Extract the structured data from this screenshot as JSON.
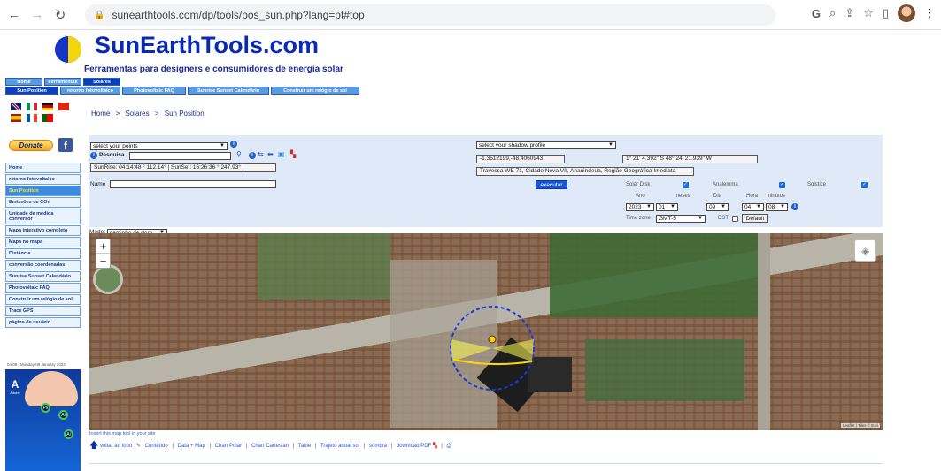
{
  "browser": {
    "url": "sunearthtools.com/dp/tools/pos_sun.php?lang=pt#top"
  },
  "site": {
    "title": "SunEarthTools.com",
    "subtitle": "Ferramentas para designers e consumidores de energia solar"
  },
  "tabs_top": [
    "Home",
    "Ferramentas",
    "Solares"
  ],
  "tabs_sub": [
    "Sun Position",
    "retorno fotovoltaico",
    "Photovoltaic FAQ",
    "Sunrise Sunset Calendário",
    "Construir um relógio de sol"
  ],
  "breadcrumb": {
    "home": "Home",
    "sep": ">",
    "section": "Solares",
    "page": "Sun Position"
  },
  "donate_label": "Donate",
  "fb_label": "f",
  "sidebar": {
    "items": [
      "Home",
      "retorno fotovoltaico",
      "Sun Position",
      "Emissões de CO₂",
      "Unidade de medida conversor",
      "Mapa interativo completo",
      "Mapa no mapa",
      "Distância",
      "conversão coordenadas",
      "Sunrise Sunset Calendário",
      "Photovoltaic FAQ",
      "Construir um relógio de sol",
      "Trace GPS",
      "página de usuário"
    ],
    "date": "04:08 | Monday 09 January 2023"
  },
  "ad": {
    "brand": "Adobe",
    "letter": "A",
    "apps": [
      "Ps",
      "Ai",
      "Ai"
    ]
  },
  "panel": {
    "points_select": "select your points",
    "search_label": "Pesquisa",
    "search_value": "",
    "sun_times": "SunRise: 04:14:48 ° 112.14° | SunSet: 16:26:36 ° 247.93° |",
    "name_label": "Name",
    "name_value": "",
    "shadow_select": "select your shadow profile",
    "coords_decimal": "-1.3512199,-48.4060943",
    "coords_dms": "1° 21' 4.392\" S    48° 24' 21.939\" W",
    "address": "Travessa WE 71, Cidade Nova VII, Ananindeua, Região Geográfica Imediata",
    "execute_label": "executar",
    "solar_disk": "Solar Disk",
    "analemma": "Analemma",
    "solstice": "Solstice",
    "year_label": "Ano",
    "month_label": "meses",
    "day_label": "Dia",
    "hour_label": "Hora",
    "minute_label": "minutos",
    "year": "2023",
    "month": "01",
    "day": "09",
    "hour": "04",
    "minute": "08",
    "timezone_label": "Time zone",
    "timezone": "GMT-5",
    "dst_label": "DST",
    "default_label": "Default"
  },
  "map": {
    "mode_label": "Mode:",
    "mode_value": "caminho de dom",
    "zoom_in": "+",
    "zoom_out": "−",
    "attribution": "Leaflet | Tiles © Esri"
  },
  "footer": {
    "embed": "Insert this map tool in your site",
    "back_top": "voltar ao topo",
    "contents": "Conteúdo",
    "links": [
      "Data + Map",
      "Chart Polar",
      "Chart Cartesian",
      "Table",
      "Trajeto anual sol",
      "sombra",
      "download PDF"
    ]
  },
  "colors": {
    "brand_blue": "#0a2ab4",
    "panel_bg": "#dfe9f7",
    "execute_btn": "#1655d8"
  }
}
